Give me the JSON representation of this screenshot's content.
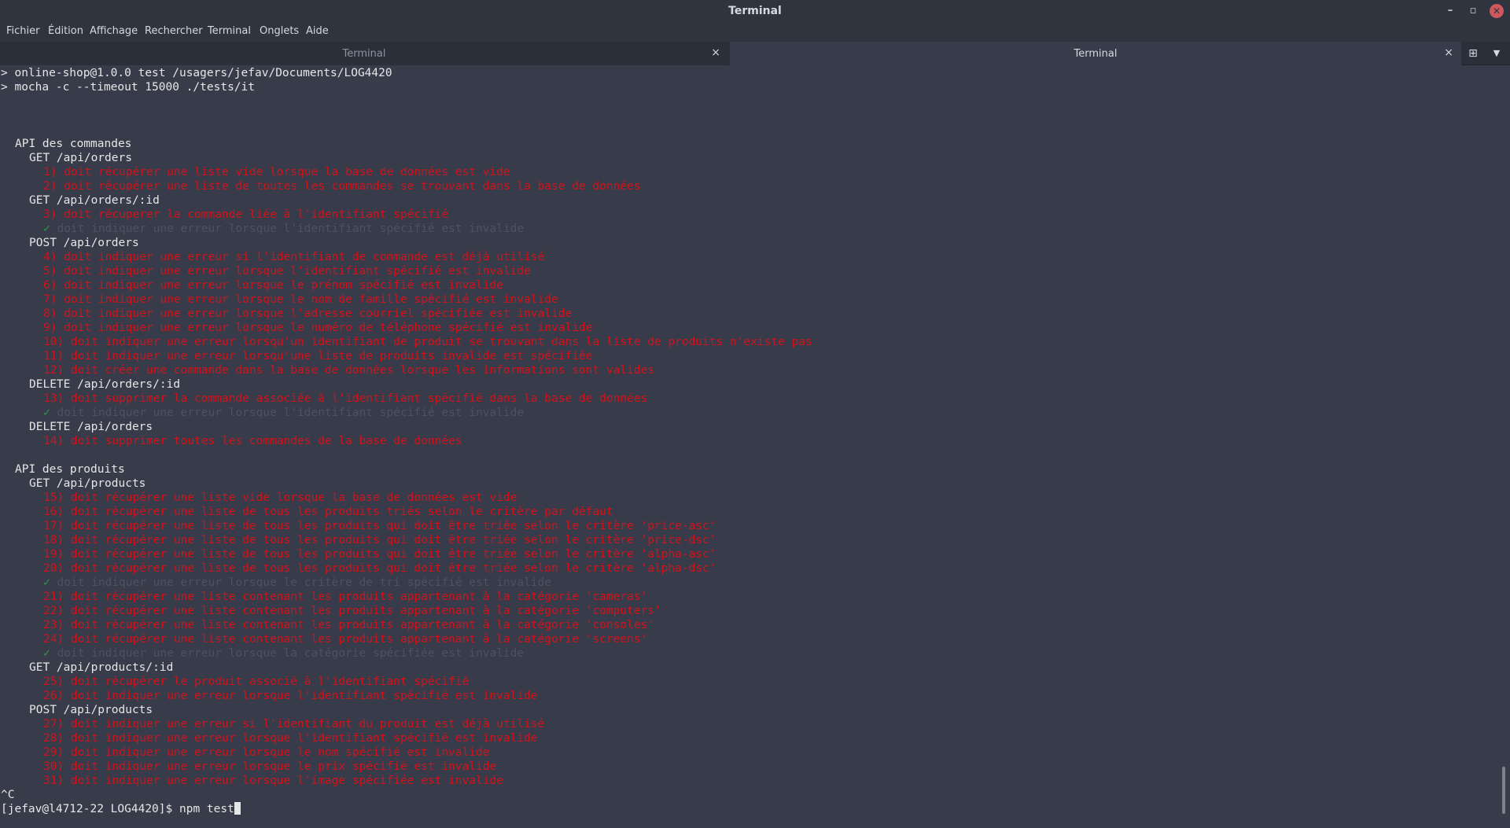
{
  "window": {
    "title": "Terminal"
  },
  "menu": [
    "Fichier",
    "Édition",
    "Affichage",
    "Rechercher",
    "Terminal",
    "Onglets",
    "Aide"
  ],
  "tabs": [
    {
      "label": "Terminal",
      "active": false
    },
    {
      "label": "Terminal",
      "active": true
    }
  ],
  "icons": {
    "close": "×",
    "minimize": "–",
    "restore": "▫",
    "window_close": "✕",
    "new_tab": "⊞",
    "tab_menu": "▼"
  },
  "terminal": {
    "header": [
      "> online-shop@1.0.0 test /usagers/jefav/Documents/LOG4420",
      "> mocha -c --timeout 15000 ./tests/it"
    ],
    "lines": [
      {
        "type": "blank"
      },
      {
        "type": "blank"
      },
      {
        "type": "blank"
      },
      {
        "type": "suite",
        "text": "API des commandes"
      },
      {
        "type": "sub",
        "text": "GET /api/orders"
      },
      {
        "type": "fail",
        "text": "1) doit récupérer une liste vide lorsque la base de données est vide"
      },
      {
        "type": "fail",
        "text": "2) doit récupérer une liste de toutes les commandes se trouvant dans la base de données"
      },
      {
        "type": "sub",
        "text": "GET /api/orders/:id"
      },
      {
        "type": "fail",
        "text": "3) doit récuperer la commande liée à l'identifiant spécifié"
      },
      {
        "type": "pass",
        "text": "doit indiquer une erreur lorsque l'identifiant spécifié est invalide"
      },
      {
        "type": "sub",
        "text": "POST /api/orders"
      },
      {
        "type": "fail",
        "text": "4) doit indiquer une erreur si l'identifiant de commande est déjà utilisé"
      },
      {
        "type": "fail",
        "text": "5) doit indiquer une erreur lorsque l'identifiant spécifié est invalide"
      },
      {
        "type": "fail",
        "text": "6) doit indiquer une erreur lorsque le prénom spécifié est invalide"
      },
      {
        "type": "fail",
        "text": "7) doit indiquer une erreur lorsque le nom de famille spécifié est invalide"
      },
      {
        "type": "fail",
        "text": "8) doit indiquer une erreur lorsque l'adresse courriel spécifiée est invalide"
      },
      {
        "type": "fail",
        "text": "9) doit indiquer une erreur lorsque le numéro de téléphone spécifié est invalide"
      },
      {
        "type": "fail",
        "text": "10) doit indiquer une erreur lorsqu'un identifiant de produit se trouvant dans la liste de produits n'existe pas"
      },
      {
        "type": "fail",
        "text": "11) doit indiquer une erreur lorsqu'une liste de produits invalide est spécifiée"
      },
      {
        "type": "fail",
        "text": "12) doit créer une commande dans la base de données lorsque les informations sont valides"
      },
      {
        "type": "sub",
        "text": "DELETE /api/orders/:id"
      },
      {
        "type": "fail",
        "text": "13) doit supprimer la commande associée à l'identifiant spécifié dans la base de données"
      },
      {
        "type": "pass",
        "text": "doit indiquer une erreur lorsque l'identifiant spécifié est invalide"
      },
      {
        "type": "sub",
        "text": "DELETE /api/orders"
      },
      {
        "type": "fail",
        "text": "14) doit supprimer toutes les commandes de la base de données"
      },
      {
        "type": "blank"
      },
      {
        "type": "suite",
        "text": "API des produits"
      },
      {
        "type": "sub",
        "text": "GET /api/products"
      },
      {
        "type": "fail",
        "text": "15) doit récupérer une liste vide lorsque la base de données est vide"
      },
      {
        "type": "fail",
        "text": "16) doit récupérer une liste de tous les produits triés selon le critère par défaut"
      },
      {
        "type": "fail",
        "text": "17) doit récupérer une liste de tous les produits qui doit être triée selon le critère 'price-asc'"
      },
      {
        "type": "fail",
        "text": "18) doit récupérer une liste de tous les produits qui doit être triée selon le critère 'price-dsc'"
      },
      {
        "type": "fail",
        "text": "19) doit récupérer une liste de tous les produits qui doit être triée selon le critère 'alpha-asc'"
      },
      {
        "type": "fail",
        "text": "20) doit récupérer une liste de tous les produits qui doit être triée selon le critère 'alpha-dsc'"
      },
      {
        "type": "pass",
        "text": "doit indiquer une erreur lorsque le critère de tri spécifié est invalide"
      },
      {
        "type": "fail",
        "text": "21) doit récupérer une liste contenant les produits appartenant à la catégorie 'cameras'"
      },
      {
        "type": "fail",
        "text": "22) doit récupérer une liste contenant les produits appartenant à la catégorie 'computers'"
      },
      {
        "type": "fail",
        "text": "23) doit récupérer une liste contenant les produits appartenant à la catégorie 'consoles'"
      },
      {
        "type": "fail",
        "text": "24) doit récupérer une liste contenant les produits appartenant à la catégorie 'screens'"
      },
      {
        "type": "pass",
        "text": "doit indiquer une erreur lorsque la catégorie spécifiée est invalide"
      },
      {
        "type": "sub",
        "text": "GET /api/products/:id"
      },
      {
        "type": "fail",
        "text": "25) doit récupérer le produit associé à l'identifiant spécifié"
      },
      {
        "type": "fail",
        "text": "26) doit indiquer une erreur lorsque l'identifiant spécifié est invalide"
      },
      {
        "type": "sub",
        "text": "POST /api/products"
      },
      {
        "type": "fail",
        "text": "27) doit indiquer une erreur si l'identifiant du produit est déjà utilisé"
      },
      {
        "type": "fail",
        "text": "28) doit indiquer une erreur lorsque l'identifiant spécifié est invalide"
      },
      {
        "type": "fail",
        "text": "29) doit indiquer une erreur lorsque le nom spécifié est invalide"
      },
      {
        "type": "fail",
        "text": "30) doit indiquer une erreur lorsque le prix spécifié est invalide"
      },
      {
        "type": "fail",
        "text": "31) doit indiquer une erreur lorsque l'image spécifiée est invalide"
      },
      {
        "type": "raw",
        "text": "^C"
      }
    ],
    "pass_mark": "✓",
    "prompt": "[jefav@l4712-22 LOG4420]$ ",
    "command": "npm test"
  }
}
